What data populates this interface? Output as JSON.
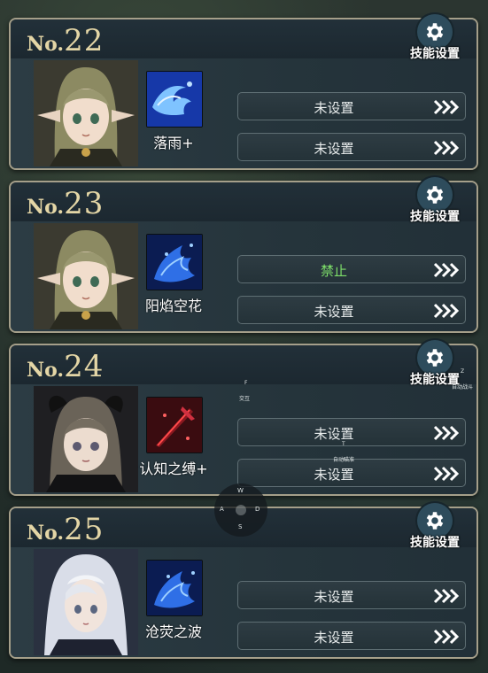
{
  "gear_label": "技能设置",
  "slots": [
    {
      "prefix": "No.",
      "number": "22",
      "skill_name": "落雨+",
      "bar1": "未设置",
      "bar2": "未设置"
    },
    {
      "prefix": "No.",
      "number": "23",
      "skill_name": "阳焰空花",
      "bar1": "禁止",
      "bar2": "未设置"
    },
    {
      "prefix": "No.",
      "number": "24",
      "skill_name": "认知之缚+",
      "bar1": "未设置",
      "bar2": "未设置"
    },
    {
      "prefix": "No.",
      "number": "25",
      "skill_name": "沧荧之波",
      "bar1": "未设置",
      "bar2": "未设置"
    }
  ],
  "overlay": {
    "dpad": {
      "up": "W",
      "left": "A",
      "right": "D",
      "down": "S"
    },
    "key_f": "F",
    "key_f_label": "交互",
    "key_t": "T",
    "key_t_label": "自动瞄准",
    "key_z": "Z",
    "key_z_label": "自动战斗"
  },
  "colors": {
    "card_border": "#a59f8a",
    "number_gold": "#e4d6a6",
    "forbid_green": "#7ee06a",
    "gear_circle": "#2e4c5c"
  },
  "icons": [
    "gear-icon",
    "chevron-triple-right-icon"
  ]
}
